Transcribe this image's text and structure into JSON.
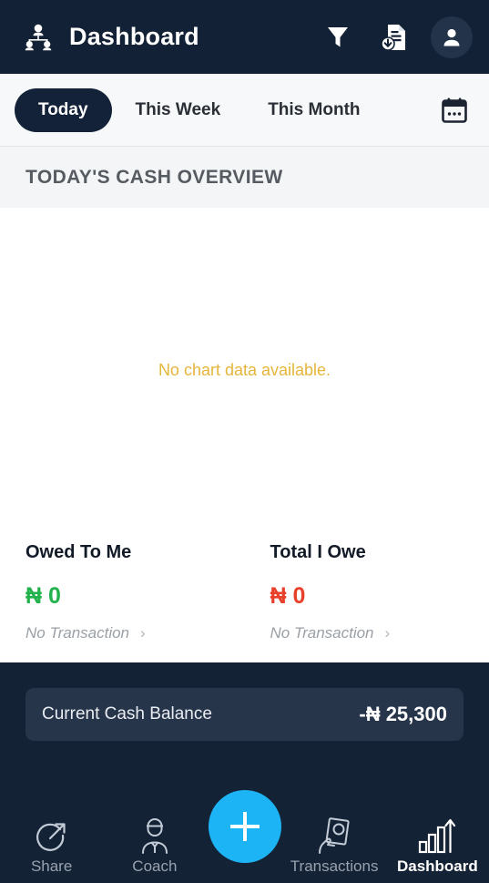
{
  "header": {
    "title": "Dashboard",
    "org_icon": "organization-hierarchy-icon",
    "filter_icon": "filter-funnel-icon",
    "export_icon": "document-download-icon",
    "avatar_icon": "person-avatar-icon"
  },
  "period_tabs": {
    "items": [
      {
        "label": "Today",
        "active": true
      },
      {
        "label": "This Week",
        "active": false
      },
      {
        "label": "This Month",
        "active": false
      }
    ],
    "calendar_icon": "calendar-icon"
  },
  "section": {
    "title": "TODAY'S CASH OVERVIEW"
  },
  "chart": {
    "empty_message": "No chart data available.",
    "empty_color": "#e6b53c"
  },
  "summary": {
    "owed_to_me": {
      "title": "Owed To Me",
      "currency": "₦",
      "amount": "0",
      "subtitle": "No Transaction",
      "color": "#22b24c"
    },
    "total_i_owe": {
      "title": "Total I Owe",
      "currency": "₦",
      "amount": "0",
      "subtitle": "No Transaction",
      "color": "#e8402a"
    }
  },
  "balance": {
    "label": "Current Cash Balance",
    "value": "-₦ 25,300"
  },
  "bottom_nav": {
    "items": [
      {
        "label": "Share",
        "icon": "share-arrow-icon",
        "active": false
      },
      {
        "label": "Coach",
        "icon": "coach-person-icon",
        "active": false
      },
      {
        "label": "Transactions",
        "icon": "hand-money-icon",
        "active": false
      },
      {
        "label": "Dashboard",
        "icon": "bar-chart-growth-icon",
        "active": true
      }
    ],
    "fab": {
      "label": "+",
      "icon": "plus-icon",
      "color": "#1CB4F5"
    }
  },
  "chart_data": {
    "type": "bar",
    "title": "TODAY'S CASH OVERVIEW",
    "categories": [],
    "values": [],
    "series": [],
    "xlabel": "",
    "ylabel": "",
    "empty": true,
    "empty_message": "No chart data available."
  }
}
